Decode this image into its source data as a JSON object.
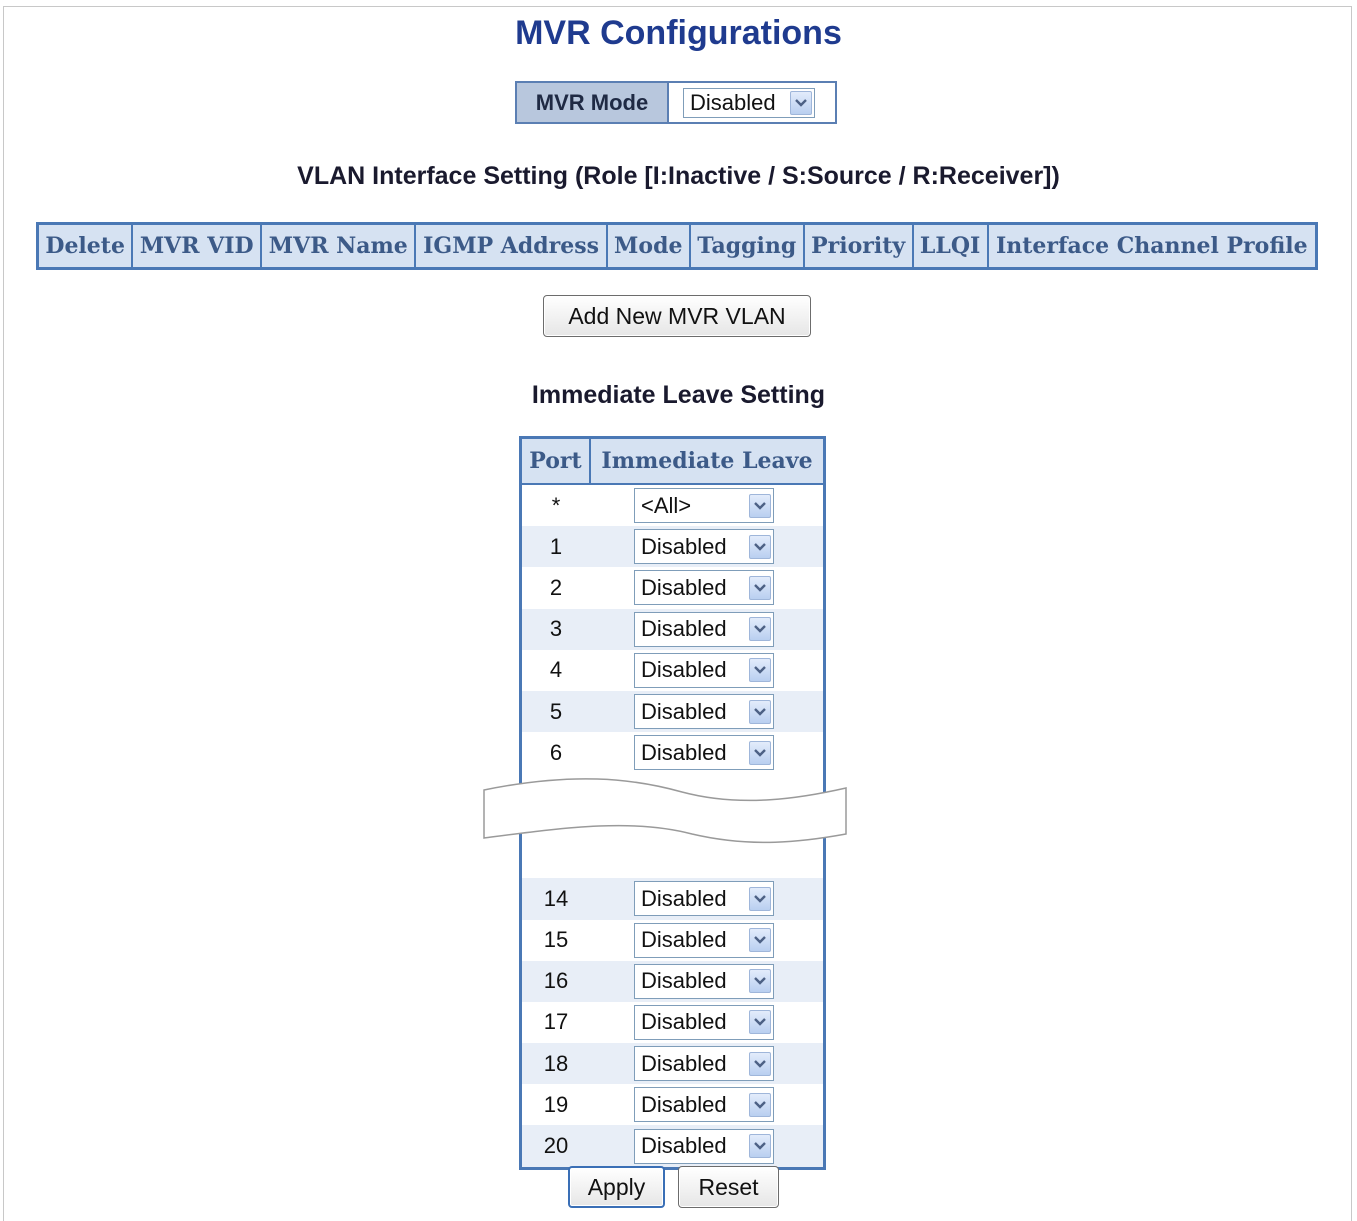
{
  "page": {
    "title": "MVR Configurations"
  },
  "mvr_mode": {
    "label": "MVR Mode",
    "value": "Disabled"
  },
  "vlan_section": {
    "title": "VLAN Interface Setting (Role [I:Inactive / S:Source / R:Receiver])",
    "columns": [
      "Delete",
      "MVR VID",
      "MVR Name",
      "IGMP Address",
      "Mode",
      "Tagging",
      "Priority",
      "LLQI",
      "Interface Channel Profile"
    ],
    "add_button": "Add New MVR VLAN"
  },
  "leave_section": {
    "title": "Immediate Leave Setting",
    "headers": {
      "port": "Port",
      "immediate_leave": "Immediate Leave"
    },
    "rows_top": [
      {
        "port": "*",
        "value": "<All>"
      },
      {
        "port": "1",
        "value": "Disabled"
      },
      {
        "port": "2",
        "value": "Disabled"
      },
      {
        "port": "3",
        "value": "Disabled"
      },
      {
        "port": "4",
        "value": "Disabled"
      },
      {
        "port": "5",
        "value": "Disabled"
      },
      {
        "port": "6",
        "value": "Disabled"
      }
    ],
    "rows_bottom": [
      {
        "port": "14",
        "value": "Disabled"
      },
      {
        "port": "15",
        "value": "Disabled"
      },
      {
        "port": "16",
        "value": "Disabled"
      },
      {
        "port": "17",
        "value": "Disabled"
      },
      {
        "port": "18",
        "value": "Disabled"
      },
      {
        "port": "19",
        "value": "Disabled"
      },
      {
        "port": "20",
        "value": "Disabled"
      }
    ]
  },
  "buttons": {
    "apply": "Apply",
    "reset": "Reset"
  },
  "colors": {
    "accent": "#4a78b5",
    "title": "#1f3b8f",
    "header_bg": "#d6e2f2",
    "header_text": "#3c5a88"
  }
}
